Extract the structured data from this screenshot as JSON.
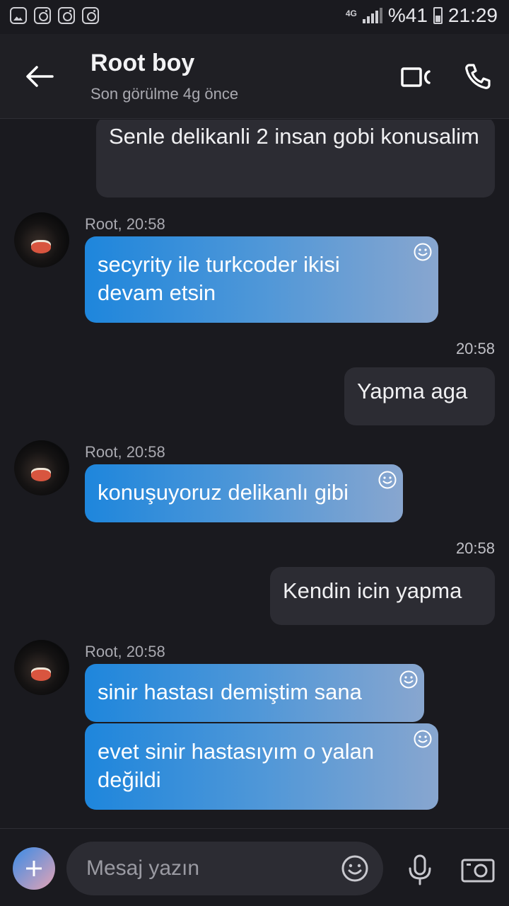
{
  "status": {
    "network": "4G",
    "battery": "%41",
    "time": "21:29"
  },
  "header": {
    "title": "Root boy",
    "subtitle": "Son görülme 4g önce"
  },
  "messages": [
    {
      "dir": "out",
      "text": "Senle delikanli 2 insan gobi konusalim"
    },
    {
      "dir": "in",
      "meta": "Root, 20:58",
      "text": "secyrity ile turkcoder ikisi devam etsin"
    },
    {
      "dir": "out",
      "time": "20:58",
      "text": "Yapma aga"
    },
    {
      "dir": "in",
      "meta": "Root, 20:58",
      "text": "konuşuyoruz delikanlı gibi"
    },
    {
      "dir": "out",
      "time": "20:58",
      "text": "Kendin icin yapma"
    },
    {
      "dir": "in",
      "meta": "Root, 20:58",
      "text": "sinir hastası demiştim sana"
    },
    {
      "dir": "in",
      "text": "evet sinir hastasıyım o yalan değildi"
    }
  ],
  "composer": {
    "placeholder": "Mesaj yazın"
  },
  "colors": {
    "background": "#1a1a1f",
    "outgoing": "#2c2c33",
    "incoming_start": "#1e86dc",
    "incoming_end": "#88a6cf"
  }
}
